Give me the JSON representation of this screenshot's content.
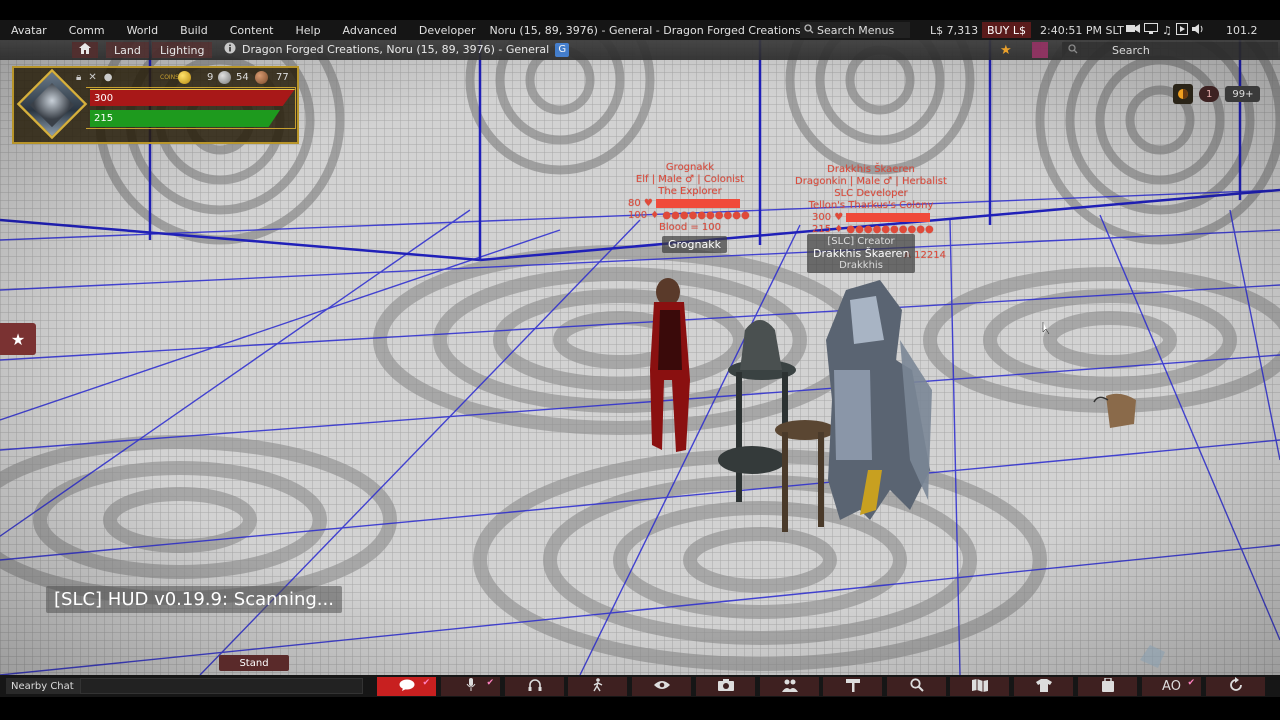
{
  "menubar": {
    "items": [
      "Avatar",
      "Comm",
      "World",
      "Build",
      "Content",
      "Help",
      "Advanced",
      "Developer"
    ],
    "location": "Noru (15, 89, 3976) - General - Dragon Forged Creations",
    "search_menus": "Search Menus",
    "balance": "L$ 7,313",
    "buy": "BUY L$",
    "clock": "2:40:51 PM SLT",
    "fps": "101.2"
  },
  "navbar": {
    "land": "Land",
    "lighting": "Lighting",
    "parcel": "Dragon Forged Creations, Noru (15, 89, 3976) - General",
    "group_badge": "G",
    "search": "Search"
  },
  "hud": {
    "coins_label": "COINS",
    "count_a": "9",
    "count_b": "54",
    "count_c": "77",
    "health": "300",
    "stamina": "215"
  },
  "right_hud": {
    "badge_one": "1",
    "badge_more": "99+"
  },
  "avatars": {
    "grognakk": {
      "name": "Grognakk",
      "line1": "Elf | Male ♂ | Colonist",
      "line2": "The Explorer",
      "hp": "80",
      "mp": "100",
      "mp_dots": "●●●●●●●●●●",
      "blood": "Blood = 100",
      "plate": "Grognakk"
    },
    "drakkhis": {
      "name": "Drakkhis Škaeren",
      "line1": "Dragonkin | Male ♂ | Herbalist",
      "line2": "SLC Developer",
      "line3": "Tellon's Tharkus's Colony",
      "hp": "300",
      "mp": "215",
      "mp_dots": "●●●●●●●●●●",
      "extra": "A 12214",
      "plate_role": "[SLC] Creator",
      "plate_name": "Drakkhis Škaeren",
      "plate_sub": "Drakkhis"
    }
  },
  "scan_message": "[SLC] HUD v0.19.9: Scanning...",
  "stand": "Stand",
  "bottombar": {
    "chat_label": "Nearby Chat",
    "ao": "AO"
  },
  "icons": [
    "home-icon",
    "info-icon",
    "search-icon",
    "star-icon",
    "chat-icon",
    "microphone-icon",
    "headset-icon",
    "walk-icon",
    "eye-icon",
    "camera-icon",
    "people-icon",
    "build-icon",
    "search-icon",
    "map-icon",
    "shirt-icon",
    "inventory-icon",
    "ao-icon",
    "refresh-icon"
  ],
  "colors": {
    "accent_red": "#c82020",
    "grid_blue": "#2a2ad0",
    "hud_gold": "#b8952a",
    "health_red": "#a81818",
    "stamina_green": "#1e9a1e",
    "tag_red": "#e04a3a"
  }
}
